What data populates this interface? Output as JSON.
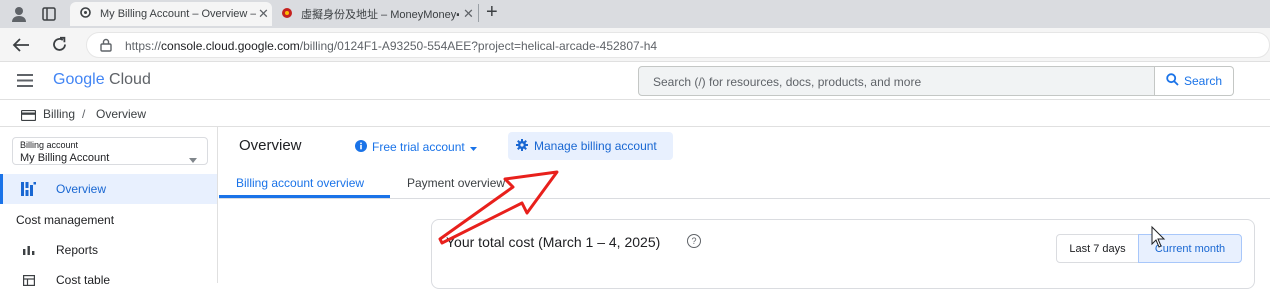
{
  "browser": {
    "tabs": [
      {
        "title": "My Billing Account – Overview – I",
        "close": "✕"
      },
      {
        "title": "虛擬身份及地址 – MoneyMoney▪",
        "close": "✕"
      }
    ],
    "new_tab": "+",
    "url_prefix": "https://",
    "url_host": "console.cloud.google.com",
    "url_path": "/billing/0124F1-A93250-554AEE?project=helical-arcade-452807-h4"
  },
  "header": {
    "logo_google": "Google",
    "logo_cloud": "Cloud",
    "search_placeholder": "Search (/) for resources, docs, products, and more",
    "search_button": "Search"
  },
  "breadcrumb": {
    "item1": "Billing",
    "separator": "/",
    "item2": "Overview"
  },
  "sidebar": {
    "account_label": "Billing account",
    "account_value": "My Billing Account",
    "nav_overview": "Overview",
    "section_cost": "Cost management",
    "nav_reports": "Reports",
    "nav_cost_table": "Cost table"
  },
  "main": {
    "title": "Overview",
    "free_trial": "Free trial account",
    "manage_billing": "Manage billing account",
    "tab_overview": "Billing account overview",
    "tab_payment": "Payment overview",
    "total_cost": "Your total cost (March 1 – 4, 2025)",
    "help_icon": "?",
    "btn_last7": "Last 7 days",
    "btn_current": "Current month"
  },
  "colors": {
    "accent": "#1a73e8",
    "annotation_arrow": "#e8201c",
    "selected_bg": "#e8f0fe"
  }
}
